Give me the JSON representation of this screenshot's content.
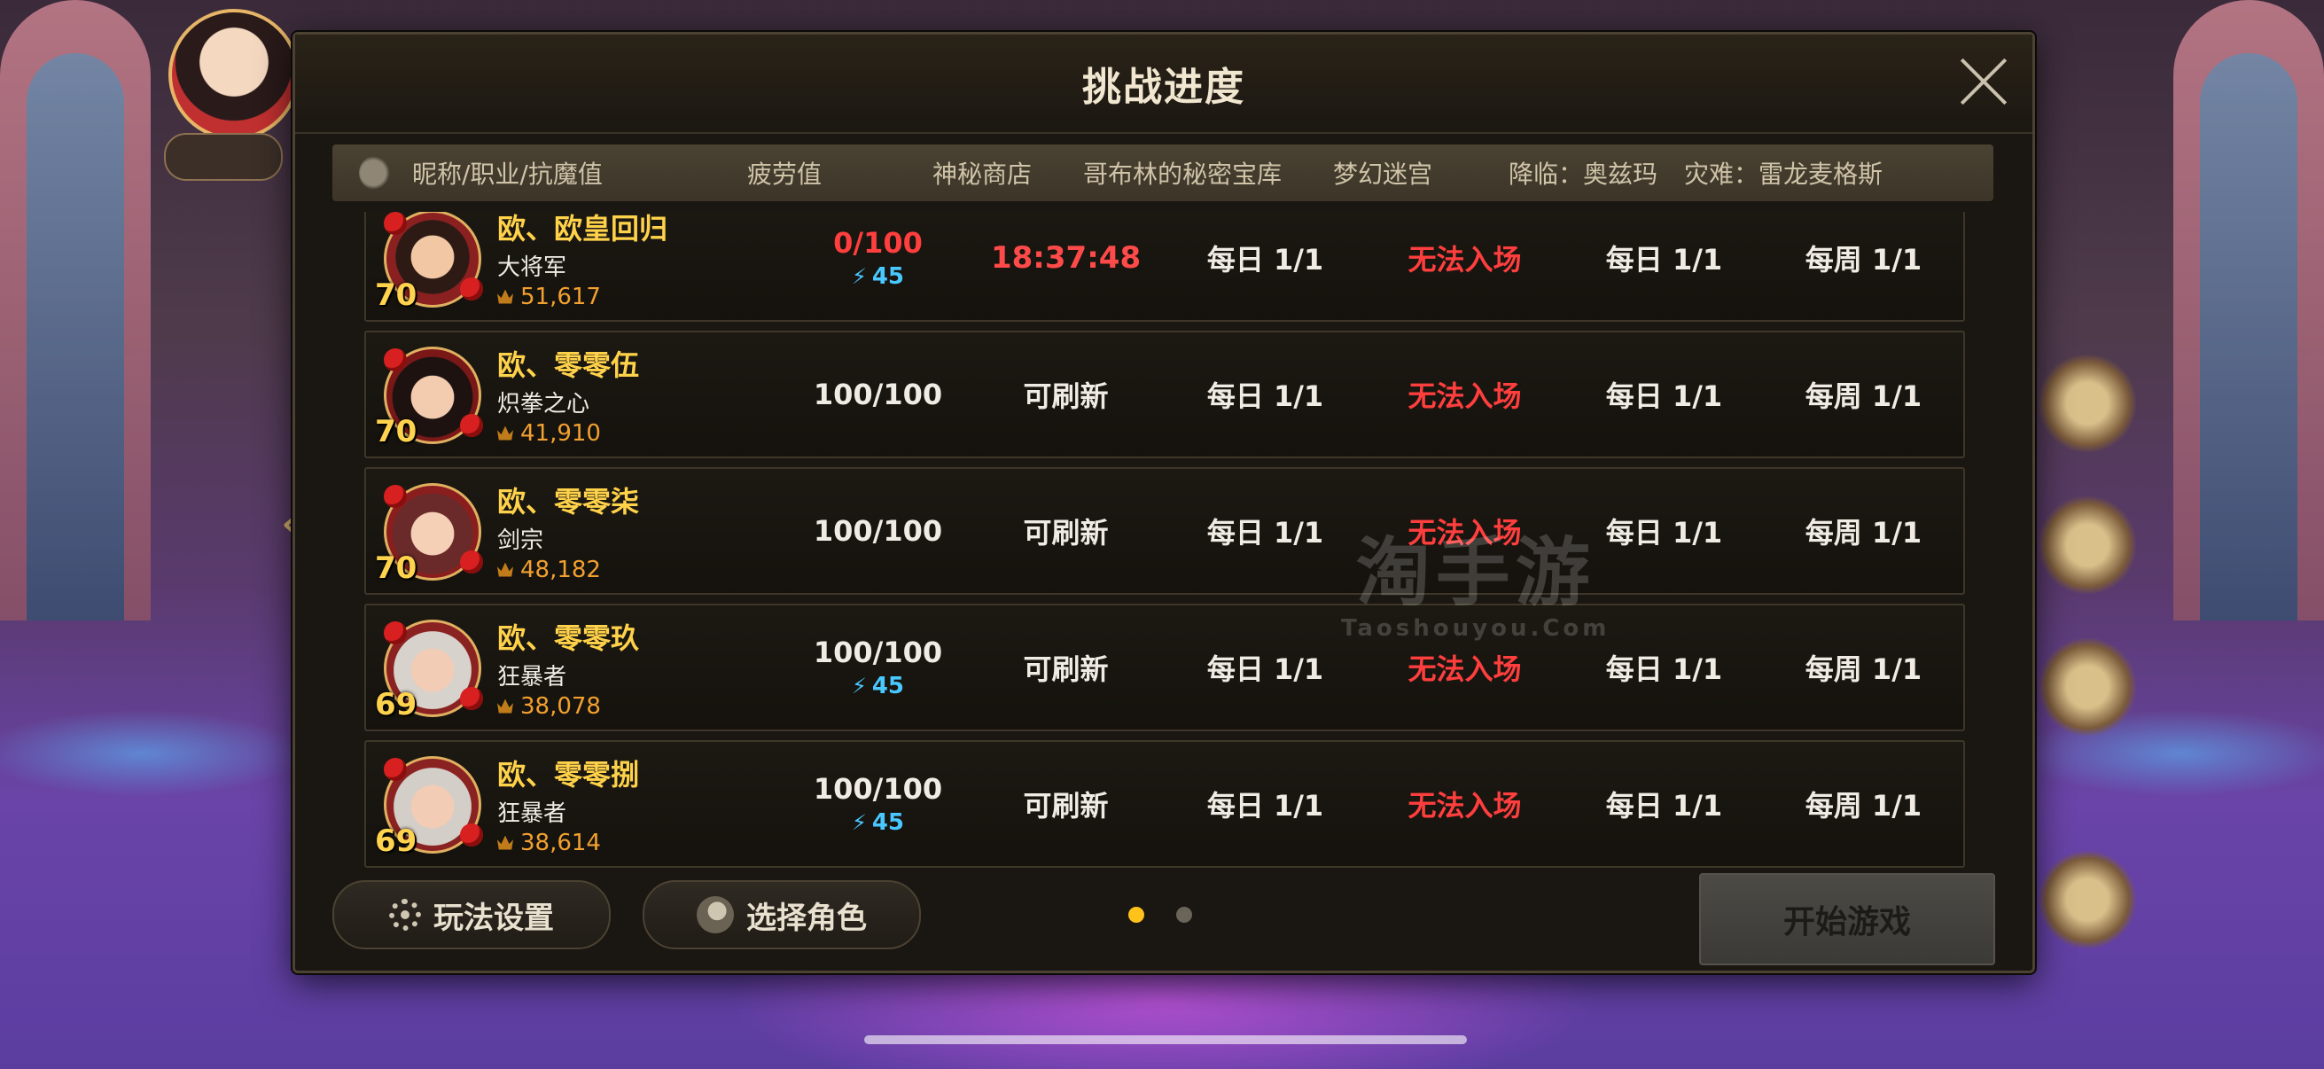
{
  "dialog": {
    "title": "挑战进度",
    "headers": [
      "昵称/职业/抗魔值",
      "疲劳值",
      "神秘商店",
      "哥布林的秘密宝库",
      "梦幻迷宫",
      "降临：奥兹玛",
      "灾难：雷龙麦格斯"
    ],
    "rows": [
      {
        "name": "欧、欧皇回归",
        "job": "大将军",
        "power": "51,617",
        "level": "70",
        "fatigue": "0/100",
        "fatigue_red": true,
        "bonus": "45",
        "shop": "18:37:48",
        "goblin": "每日 1/1",
        "maze": "无法入场",
        "ozma": "每日 1/1",
        "magus": "每周 1/1"
      },
      {
        "name": "欧、零零伍",
        "job": "炽拳之心",
        "power": "41,910",
        "level": "70",
        "fatigue": "100/100",
        "fatigue_red": false,
        "bonus": "",
        "shop": "可刷新",
        "goblin": "每日 1/1",
        "maze": "无法入场",
        "ozma": "每日 1/1",
        "magus": "每周 1/1"
      },
      {
        "name": "欧、零零柒",
        "job": "剑宗",
        "power": "48,182",
        "level": "70",
        "fatigue": "100/100",
        "fatigue_red": false,
        "bonus": "",
        "shop": "可刷新",
        "goblin": "每日 1/1",
        "maze": "无法入场",
        "ozma": "每日 1/1",
        "magus": "每周 1/1"
      },
      {
        "name": "欧、零零玖",
        "job": "狂暴者",
        "power": "38,078",
        "level": "69",
        "fatigue": "100/100",
        "fatigue_red": false,
        "bonus": "45",
        "shop": "可刷新",
        "goblin": "每日 1/1",
        "maze": "无法入场",
        "ozma": "每日 1/1",
        "magus": "每周 1/1"
      },
      {
        "name": "欧、零零捌",
        "job": "狂暴者",
        "power": "38,614",
        "level": "69",
        "fatigue": "100/100",
        "fatigue_red": false,
        "bonus": "45",
        "shop": "可刷新",
        "goblin": "每日 1/1",
        "maze": "无法入场",
        "ozma": "每日 1/1",
        "magus": "每周 1/1"
      }
    ],
    "buttons": {
      "settings": "玩法设置",
      "select_role": "选择角色",
      "start": "开始游戏"
    },
    "pagination": {
      "pages": 2,
      "current": 1
    }
  },
  "watermark": {
    "line1": "淘手游",
    "line2": "Taoshouyou.Com"
  },
  "icons": {
    "close": "close-icon",
    "settings": "gear-icon",
    "select_role": "person-icon",
    "header": "dragon-icon",
    "power": "crown-icon",
    "fatigue_bonus": "lightning-icon"
  },
  "colors": {
    "name": "#ffd24a",
    "red": "#ff3e3e",
    "bonus": "#49c8ff",
    "power": "#f2a030",
    "active_dot": "#ffc21a"
  }
}
